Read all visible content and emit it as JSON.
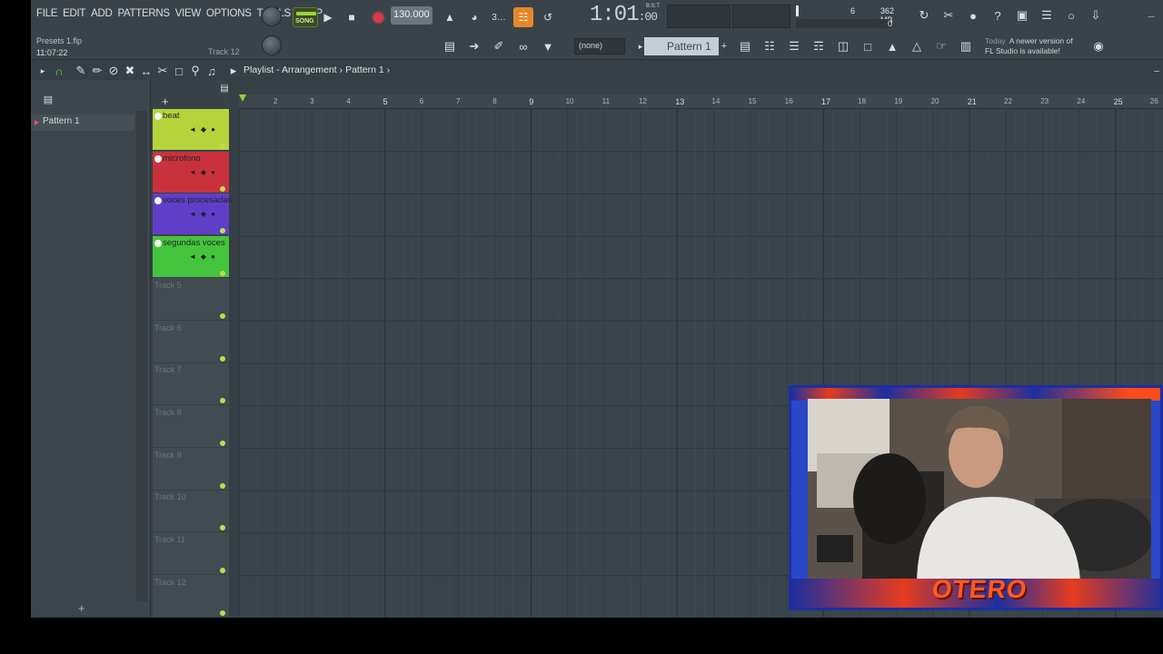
{
  "menu": [
    "FILE",
    "EDIT",
    "ADD",
    "PATTERNS",
    "VIEW",
    "OPTIONS",
    "TOOLS",
    "HELP"
  ],
  "hint": {
    "file": "Presets 1.flp",
    "clock": "11:07:22",
    "track_hint": "Track 12"
  },
  "transport": {
    "song_label": "SONG",
    "bpm": "130.000",
    "time_main": "1:01",
    "time_sub": ":00",
    "time_tag": "B:S:T"
  },
  "cpu": {
    "cores": "6",
    "memory": "362 MB",
    "poly": "0"
  },
  "pattern_selector": {
    "snap": "(none)",
    "current": "Pattern 1"
  },
  "news": {
    "when": "Today",
    "message_1": "A newer version of",
    "message_2": "FL Studio is available!"
  },
  "playlist": {
    "title": "Playlist - Arrangement",
    "separator": "›",
    "pattern": "Pattern 1"
  },
  "picker": {
    "items": [
      "Pattern 1"
    ]
  },
  "tracks": [
    {
      "name": "beat",
      "color": "#b6d33c"
    },
    {
      "name": "microfono",
      "color": "#c9323d"
    },
    {
      "name": "voces procesadas",
      "color": "#5f3fc8"
    },
    {
      "name": "segundas voces",
      "color": "#45c43d"
    },
    {
      "name": "Track 5"
    },
    {
      "name": "Track 6"
    },
    {
      "name": "Track 7"
    },
    {
      "name": "Track 8"
    },
    {
      "name": "Track 9"
    },
    {
      "name": "Track 10"
    },
    {
      "name": "Track 11"
    },
    {
      "name": "Track 12"
    }
  ],
  "ruler": [
    "2",
    "3",
    "4",
    "5",
    "6",
    "7",
    "8",
    "9",
    "10",
    "11",
    "12",
    "13",
    "14",
    "15",
    "16",
    "17",
    "18",
    "19",
    "20",
    "21",
    "22",
    "23",
    "24",
    "25",
    "26"
  ],
  "webcam": {
    "brand": "OTERO"
  },
  "colors": {
    "accent": "#e8872a",
    "song_led": "#9bd33b",
    "record": "#d8394a"
  }
}
